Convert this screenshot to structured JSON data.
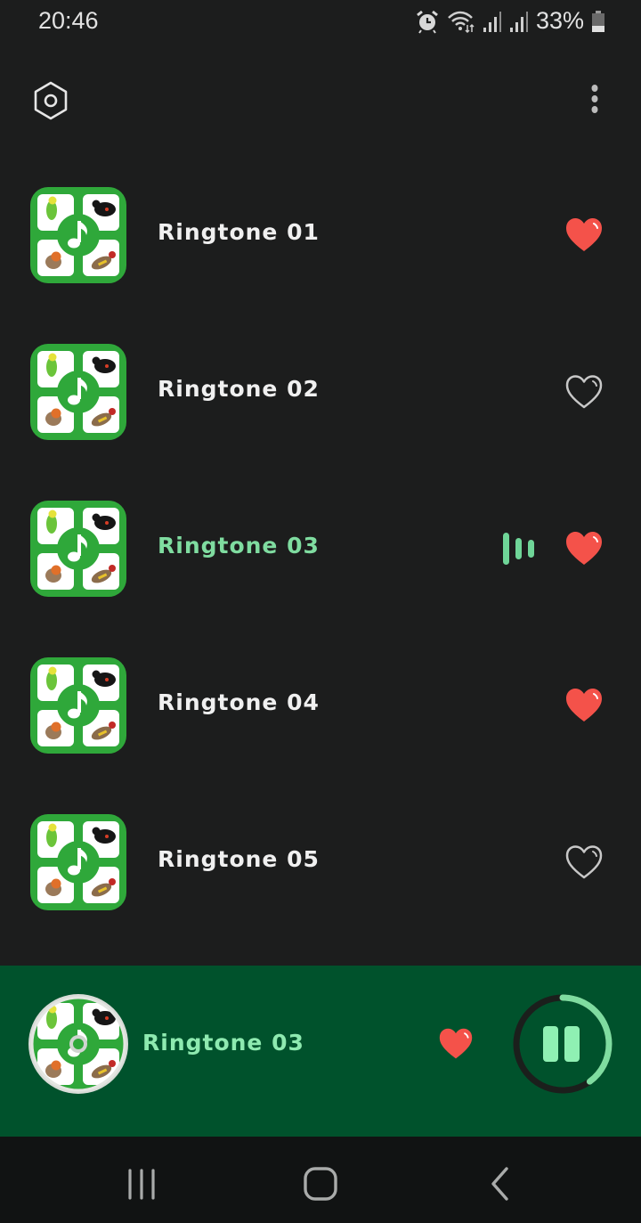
{
  "status_bar": {
    "time": "20:46",
    "battery_percent": "33%",
    "icons": [
      "alarm-icon",
      "wifi-icon",
      "signal-icon",
      "signal-icon",
      "battery-icon"
    ]
  },
  "top_bar": {
    "left_icon": "settings-icon",
    "right_icon": "more-vertical-icon"
  },
  "ringtones": [
    {
      "title": "Ringtone 01",
      "favorite": true,
      "playing": false
    },
    {
      "title": "Ringtone 02",
      "favorite": false,
      "playing": false
    },
    {
      "title": "Ringtone 03",
      "favorite": true,
      "playing": true
    },
    {
      "title": "Ringtone 04",
      "favorite": true,
      "playing": false
    },
    {
      "title": "Ringtone 05",
      "favorite": false,
      "playing": false
    }
  ],
  "player": {
    "title": "Ringtone 03",
    "favorite": true,
    "state": "playing",
    "progress_percent": 40
  },
  "colors": {
    "background": "#1c1d1d",
    "accent_green": "#7fdca0",
    "player_bg": "#00522c",
    "heart_red": "#f4524a",
    "icon_green": "#2fa83a"
  },
  "nav_bar": {
    "buttons": [
      "recent-apps",
      "home",
      "back"
    ]
  }
}
